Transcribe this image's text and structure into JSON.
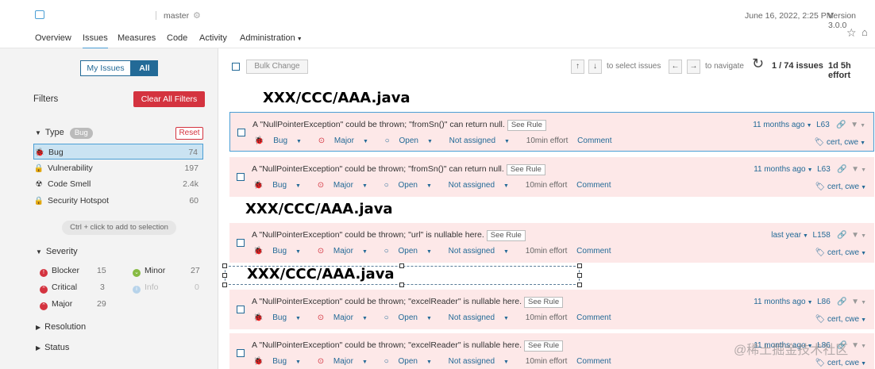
{
  "header": {
    "branch": "master",
    "date": "June 16, 2022, 2:25 PM",
    "version": "Version 3.0.0"
  },
  "nav": [
    "Overview",
    "Issues",
    "Measures",
    "Code",
    "Activity",
    "Administration"
  ],
  "sidebar": {
    "my_issues": "My Issues",
    "all": "All",
    "filters": "Filters",
    "clear_all": "Clear All Filters",
    "type_label": "Type",
    "type_badge": "Bug",
    "reset": "Reset",
    "types": [
      {
        "label": "Bug",
        "count": "74"
      },
      {
        "label": "Vulnerability",
        "count": "197"
      },
      {
        "label": "Code Smell",
        "count": "2.4k"
      },
      {
        "label": "Security Hotspot",
        "count": "60"
      }
    ],
    "hint": "Ctrl + click to add to selection",
    "severity_label": "Severity",
    "severities": [
      {
        "label": "Blocker",
        "count": "15"
      },
      {
        "label": "Minor",
        "count": "27"
      },
      {
        "label": "Critical",
        "count": "3"
      },
      {
        "label": "Info",
        "count": "0"
      },
      {
        "label": "Major",
        "count": "29"
      }
    ],
    "resolution": "Resolution",
    "status": "Status"
  },
  "toolbar": {
    "bulk_change": "Bulk Change",
    "to_select": "to select issues",
    "to_navigate": "to navigate",
    "count": "1 / 74 issues",
    "effort": "1d 5h effort"
  },
  "file_path": "XXX/CCC/AAA.java",
  "issues": [
    {
      "msg": "A \"NullPointerException\" could be thrown; \"fromSn()\" can return null.",
      "age": "11 months ago",
      "line": "L63"
    },
    {
      "msg": "A \"NullPointerException\" could be thrown; \"fromSn()\" can return null.",
      "age": "11 months ago",
      "line": "L63"
    },
    {
      "msg": "A \"NullPointerException\" could be thrown; \"url\" is nullable here.",
      "age": "last year",
      "line": "L158"
    },
    {
      "msg": "A \"NullPointerException\" could be thrown; \"excelReader\" is nullable here.",
      "age": "11 months ago",
      "line": "L86"
    },
    {
      "msg": "A \"NullPointerException\" could be thrown; \"excelReader\" is nullable here.",
      "age": "11 months ago",
      "line": "L86"
    }
  ],
  "issue_common": {
    "see_rule": "See Rule",
    "type": "Bug",
    "severity": "Major",
    "status": "Open",
    "assignee": "Not assigned",
    "effort": "10min effort",
    "comment": "Comment",
    "tags": "cert, cwe"
  },
  "watermark": "@稀土掘金技术社区",
  "colors": {
    "accent": "#236a97",
    "danger": "#d4333f",
    "issue_bg": "#fde8e8",
    "selected_border": "#4b9fd5"
  }
}
